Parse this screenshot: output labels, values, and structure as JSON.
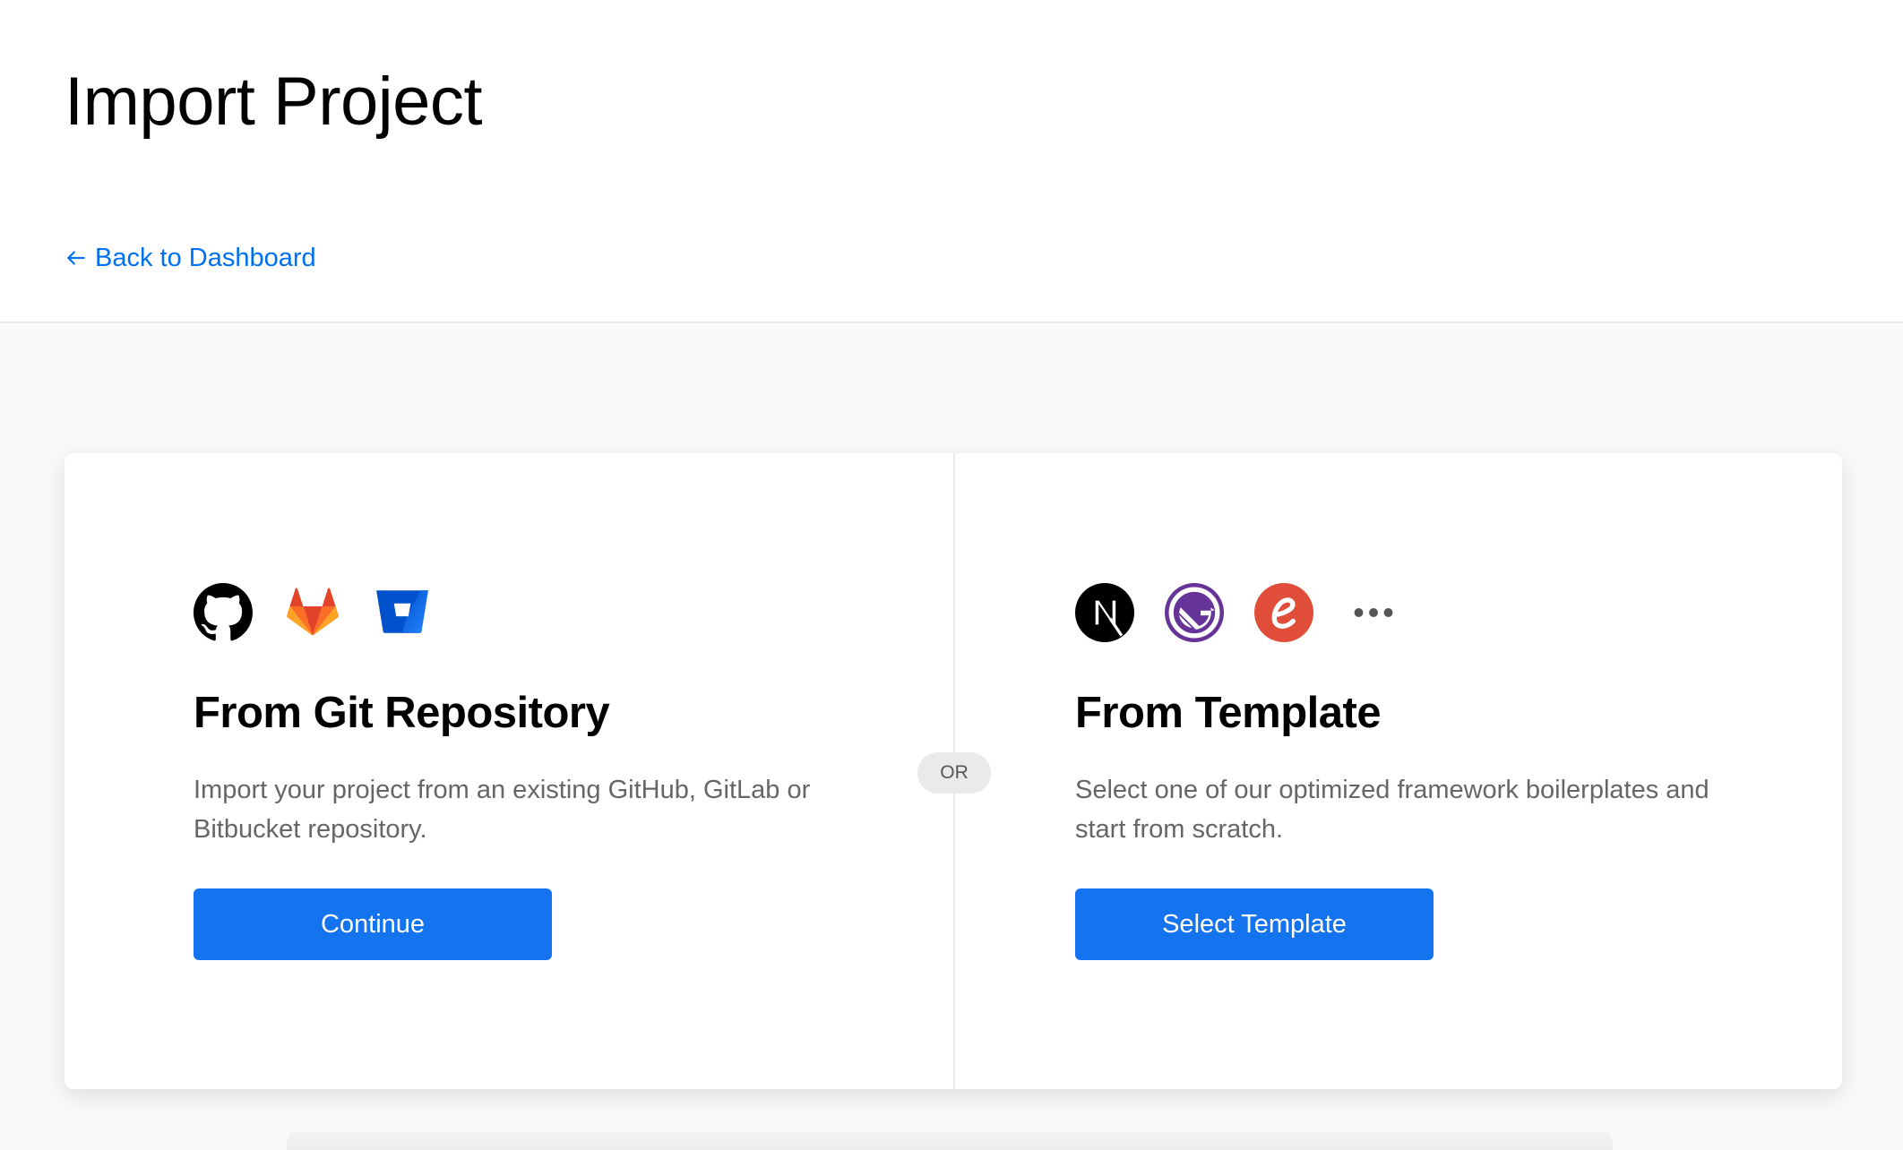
{
  "header": {
    "title": "Import Project",
    "back_link": "Back to Dashboard"
  },
  "card": {
    "divider_label": "OR",
    "git": {
      "icons": [
        "github-icon",
        "gitlab-icon",
        "bitbucket-icon"
      ],
      "title": "From Git Repository",
      "description": "Import your project from an existing GitHub, GitLab or Bitbucket repository.",
      "button": "Continue"
    },
    "template": {
      "icons": [
        "nextjs-icon",
        "gatsby-icon",
        "eleventy-icon",
        "more-icon"
      ],
      "title": "From Template",
      "description": "Select one of our optimized framework boilerplates and start from scratch.",
      "button": "Select Template"
    }
  },
  "colors": {
    "accent": "#1473ee",
    "link": "#0070f3",
    "github": "#000000",
    "gitlab": "#e24329",
    "bitbucket": "#0052cc",
    "gatsby": "#663399",
    "eleventy": "#e04e39"
  }
}
